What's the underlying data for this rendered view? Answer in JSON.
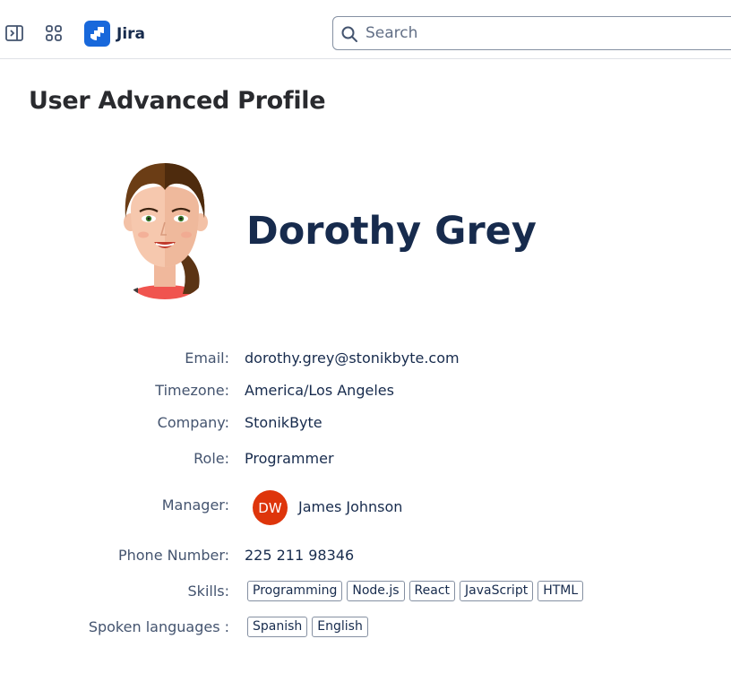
{
  "topbar": {
    "sidebar_toggle_icon": "sidebar-toggle-icon",
    "app_switcher_icon": "app-switcher-icon",
    "app_logo_icon": "jira-logo-icon",
    "app_name": "Jira",
    "search": {
      "placeholder": "Search",
      "value": ""
    }
  },
  "page": {
    "title": "User Advanced Profile"
  },
  "profile": {
    "name": "Dorothy Grey",
    "fields": {
      "email": {
        "label": "Email:",
        "value": "dorothy.grey@stonikbyte.com"
      },
      "timezone": {
        "label": "Timezone:",
        "value": "America/Los Angeles"
      },
      "company": {
        "label": "Company:",
        "value": "StonikByte"
      },
      "role": {
        "label": "Role:",
        "value": "Programmer"
      },
      "manager": {
        "label": "Manager:",
        "initials": "DW",
        "name": "James Johnson",
        "avatar_color": "#de350b"
      },
      "phone": {
        "label": "Phone Number:",
        "value": "225 211 98346"
      },
      "skills": {
        "label": "Skills:",
        "tags": [
          "Programming",
          "Node.js",
          "React",
          "JavaScript",
          "HTML"
        ]
      },
      "languages": {
        "label": "Spoken languages :",
        "tags": [
          "Spanish",
          "English"
        ]
      }
    }
  },
  "colors": {
    "brand": "#1868db",
    "heading": "#172b4d",
    "label": "#44546f",
    "manager_avatar": "#de350b"
  }
}
